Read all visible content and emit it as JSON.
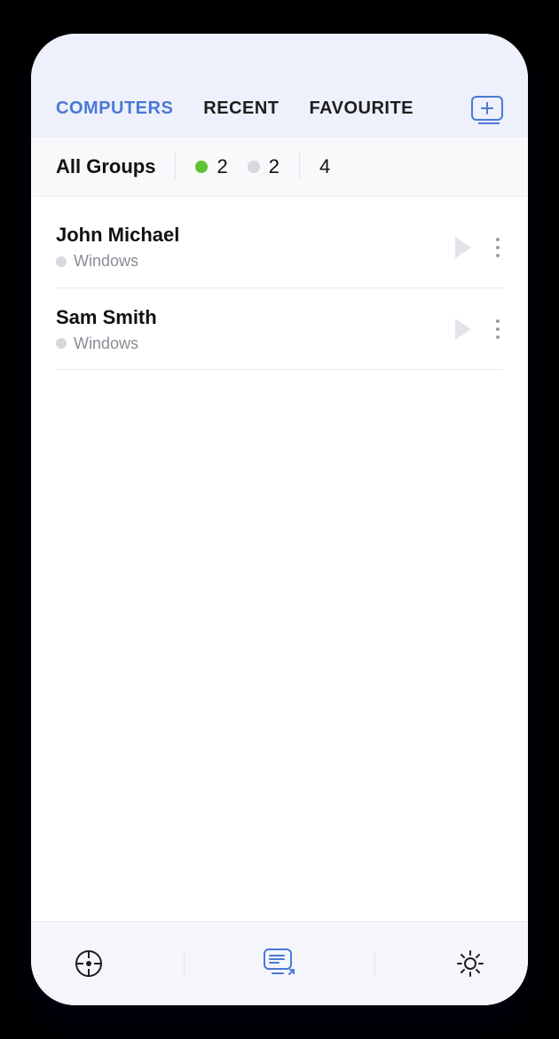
{
  "tabs": {
    "computers": "COMPUTERS",
    "recent": "RECENT",
    "favourite": "FAVOURITE",
    "active": "computers"
  },
  "groupbar": {
    "label": "All Groups",
    "online_count": "2",
    "offline_count": "2",
    "total_count": "4"
  },
  "computers": [
    {
      "name": "John Michael",
      "os": "Windows"
    },
    {
      "name": "Sam Smith",
      "os": "Windows"
    }
  ],
  "colors": {
    "accent": "#4a78d6",
    "online": "#5ec232",
    "offline": "#d6d8de"
  }
}
